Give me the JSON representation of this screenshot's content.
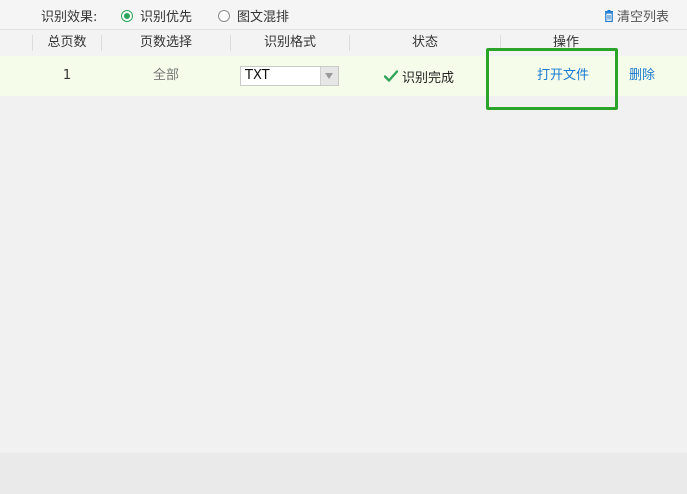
{
  "options": {
    "label": "识别效果:",
    "radios": [
      {
        "label": "识别优先",
        "checked": true
      },
      {
        "label": "图文混排",
        "checked": false
      }
    ],
    "clear_list": "清空列表"
  },
  "table": {
    "headers": [
      "总页数",
      "页数选择",
      "识别格式",
      "状态",
      "操作"
    ],
    "rows": [
      {
        "total_pages": "1",
        "page_selection": "全部",
        "format": "TXT",
        "status": "识别完成",
        "open_file": "打开文件",
        "delete": "删除"
      }
    ]
  },
  "colors": {
    "accent_green": "#2fa45a",
    "link_blue": "#1b7bd0",
    "highlight_green": "#2aa52a",
    "row_bg": "#f5fce9"
  }
}
